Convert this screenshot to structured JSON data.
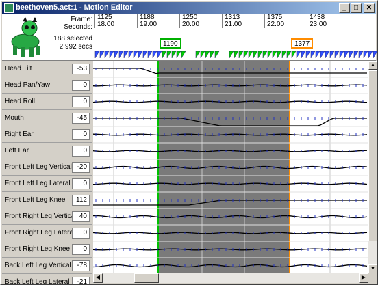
{
  "window": {
    "title": "beethoven5.act:1 - Motion Editor",
    "minimize": "_",
    "maximize": "□",
    "close": "✕"
  },
  "header": {
    "frame_label": "Frame:",
    "seconds_label": "Seconds:",
    "selected_count": "188 selected",
    "selected_secs": "2.992 secs",
    "ticks": [
      {
        "frame": "1125",
        "secs": "18.00"
      },
      {
        "frame": "1188",
        "secs": "19.00"
      },
      {
        "frame": "1250",
        "secs": "20.00"
      },
      {
        "frame": "1313",
        "secs": "21.00"
      },
      {
        "frame": "1375",
        "secs": "22.00"
      },
      {
        "frame": "1438",
        "secs": "23.00"
      }
    ],
    "selection_start": "1190",
    "selection_end": "1377",
    "colors": {
      "start": "#00b000",
      "end": "#ff8c00"
    }
  },
  "joints": [
    {
      "name": "Head Tilt",
      "value": "-53"
    },
    {
      "name": "Head Pan/Yaw",
      "value": "0"
    },
    {
      "name": "Head Roll",
      "value": "0"
    },
    {
      "name": "Mouth",
      "value": "-45"
    },
    {
      "name": "Right Ear",
      "value": "0"
    },
    {
      "name": "Left Ear",
      "value": "0"
    },
    {
      "name": "Front Left Leg Vertical",
      "value": "-20"
    },
    {
      "name": "Front Left Leg Lateral",
      "value": "0"
    },
    {
      "name": "Front Left Leg Knee",
      "value": "112"
    },
    {
      "name": "Front Right Leg Vertical",
      "value": "40"
    },
    {
      "name": "Front Right Leg Lateral",
      "value": "0"
    },
    {
      "name": "Front Right Leg Knee",
      "value": "0"
    },
    {
      "name": "Back Left Leg Vertical",
      "value": "-78"
    },
    {
      "name": "Back Left Leg Lateral",
      "value": "-21"
    }
  ]
}
